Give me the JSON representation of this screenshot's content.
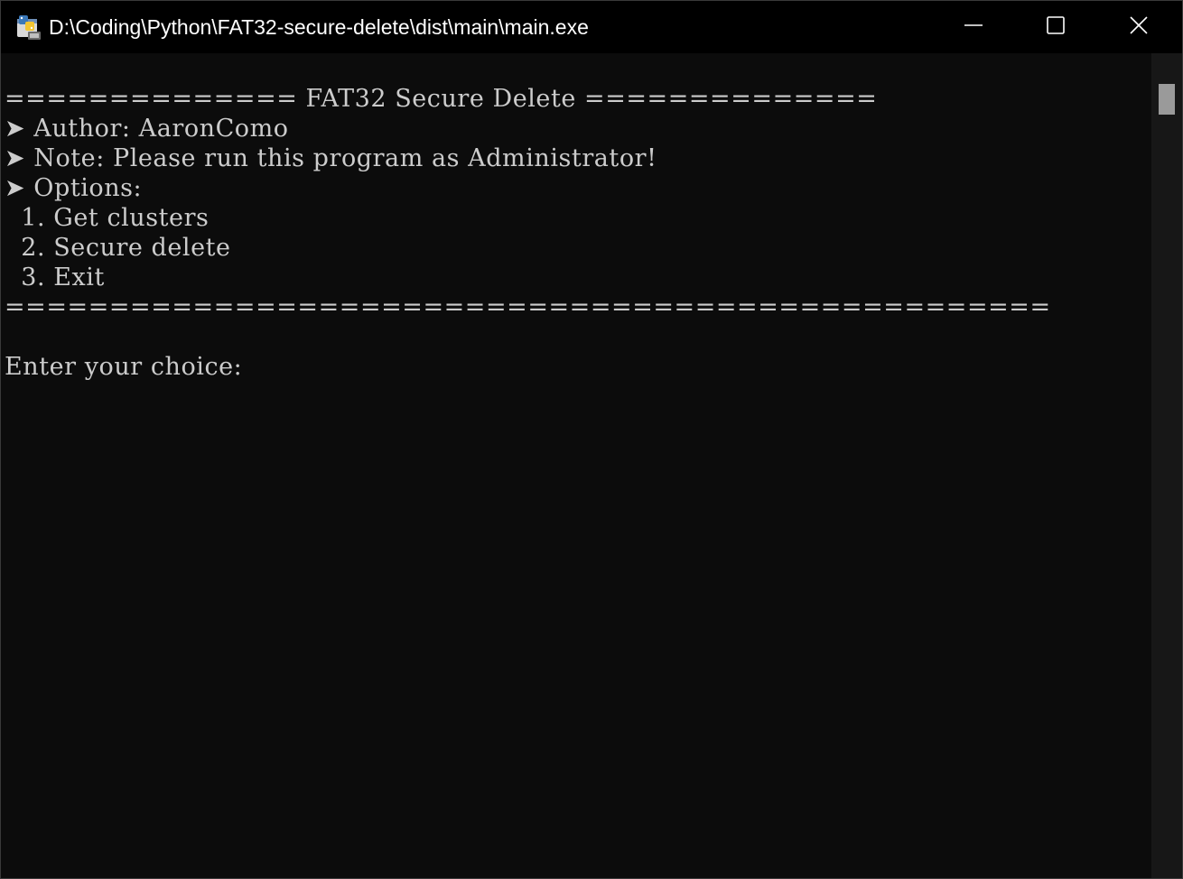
{
  "window": {
    "title": "D:\\Coding\\Python\\FAT32-secure-delete\\dist\\main\\main.exe",
    "icon": "python-exe-icon",
    "controls": {
      "minimize": "minimize-icon",
      "maximize": "maximize-icon",
      "close": "close-icon"
    }
  },
  "console": {
    "lines": [
      "============== FAT32 Secure Delete ==============",
      "➤ Author: AaronComo",
      "➤ Note: Please run this program as Administrator!",
      "➤ Options:",
      "  1. Get clusters",
      "  2. Secure delete",
      "  3. Exit",
      "==================================================",
      "",
      "Enter your choice:"
    ],
    "text_color": "#cccccc",
    "background_color": "#0c0c0c"
  }
}
